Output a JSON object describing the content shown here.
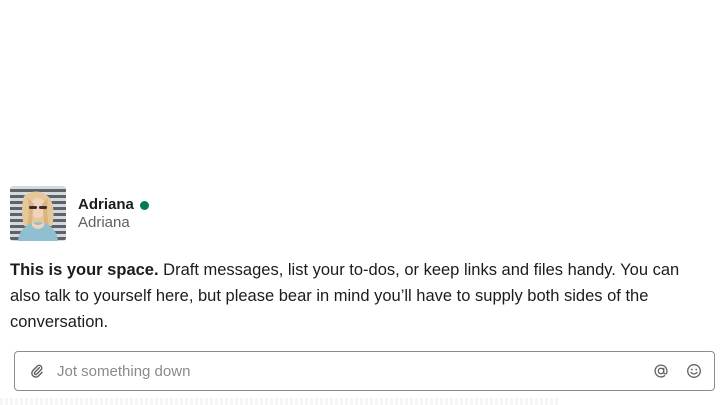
{
  "profile": {
    "display_name": "Adriana",
    "username": "Adriana",
    "presence": "active",
    "presence_color": "#007a5a"
  },
  "intro": {
    "bold": "This is your space.",
    "text": "Draft messages, list your to-dos, or keep links and files handy. You can also talk to yourself here, but please bear in mind you’ll have to supply both sides of the conversation."
  },
  "composer": {
    "placeholder": "Jot something down",
    "value": "",
    "icons": {
      "attach": "paperclip-icon",
      "mention": "at-sign-icon",
      "emoji": "emoji-icon"
    }
  },
  "colors": {
    "text": "#1d1c1d",
    "muted": "#616061",
    "border": "#8d8d8d"
  }
}
